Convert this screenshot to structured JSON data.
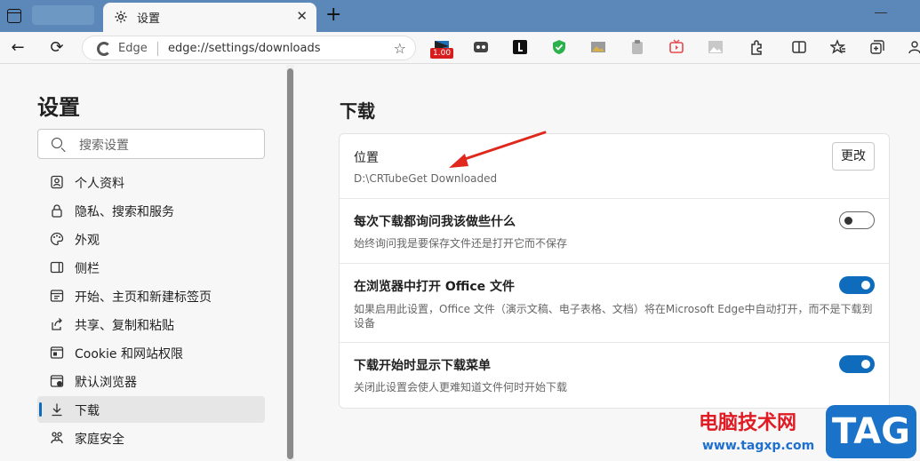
{
  "tab": {
    "title": "设置",
    "close": "✕",
    "new_tab": "+"
  },
  "toolbar": {
    "back": "←",
    "refresh": "⟳",
    "address_label": "Edge",
    "url": "edge://settings/downloads",
    "extension_badge": "1.00"
  },
  "sidebar": {
    "title": "设置",
    "search_placeholder": "搜索设置",
    "items": [
      {
        "label": "个人资料",
        "icon": "profile-icon"
      },
      {
        "label": "隐私、搜索和服务",
        "icon": "lock-icon"
      },
      {
        "label": "外观",
        "icon": "palette-icon"
      },
      {
        "label": "侧栏",
        "icon": "sidebar-icon"
      },
      {
        "label": "开始、主页和新建标签页",
        "icon": "home-icon"
      },
      {
        "label": "共享、复制和粘贴",
        "icon": "share-icon"
      },
      {
        "label": "Cookie 和网站权限",
        "icon": "cookie-icon"
      },
      {
        "label": "默认浏览器",
        "icon": "browser-icon"
      },
      {
        "label": "下载",
        "icon": "download-icon",
        "active": true
      },
      {
        "label": "家庭安全",
        "icon": "family-icon"
      }
    ]
  },
  "main": {
    "title": "下载",
    "location": {
      "title": "位置",
      "path": "D:\\CRTubeGet Downloaded",
      "button": "更改"
    },
    "ask": {
      "title": "每次下载都询问我该做些什么",
      "desc": "始终询问我是要保存文件还是打开它而不保存",
      "enabled": false
    },
    "office": {
      "title": "在浏览器中打开 Office 文件",
      "desc": "如果启用此设置，Office 文件（演示文稿、电子表格、文档）将在Microsoft Edge中自动打开，而不是下载到设备",
      "enabled": true
    },
    "menu": {
      "title": "下载开始时显示下载菜单",
      "desc": "关闭此设置会使人更难知道文件何时开始下载",
      "enabled": true
    }
  },
  "watermark": {
    "text": "电脑技术网",
    "url": "www.tagxp.com",
    "tag": "TAG"
  },
  "colors": {
    "accent": "#0f6cbd",
    "tabstrip": "#5b88b8",
    "arrow": "#e0281e",
    "watermark_red": "#e01b24",
    "watermark_blue": "#1a73c9"
  }
}
